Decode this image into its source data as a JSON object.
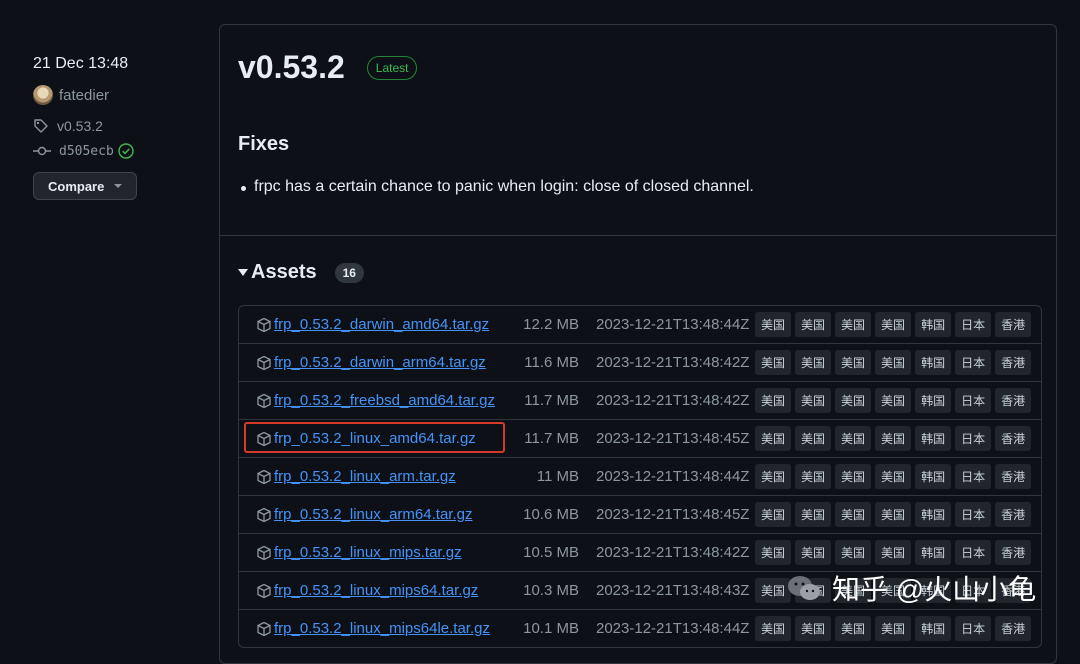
{
  "sidebar": {
    "date": "21 Dec 13:48",
    "author": "fatedier",
    "tag": "v0.53.2",
    "commit": "d505ecb",
    "compare_label": "Compare"
  },
  "release": {
    "version": "v0.53.2",
    "badge": "Latest",
    "fixes_heading": "Fixes",
    "fixes": [
      "frpc has a certain chance to panic when login: close of closed channel."
    ],
    "assets_heading": "Assets",
    "assets_count": "16",
    "mirror_labels": [
      "美国",
      "美国",
      "美国",
      "美国",
      "韩国",
      "日本",
      "香港"
    ],
    "assets": [
      {
        "name": "frp_0.53.2_darwin_amd64.tar.gz",
        "size": "12.2 MB",
        "time": "2023-12-21T13:48:44Z"
      },
      {
        "name": "frp_0.53.2_darwin_arm64.tar.gz",
        "size": "11.6 MB",
        "time": "2023-12-21T13:48:42Z"
      },
      {
        "name": "frp_0.53.2_freebsd_amd64.tar.gz",
        "size": "11.7 MB",
        "time": "2023-12-21T13:48:42Z"
      },
      {
        "name": "frp_0.53.2_linux_amd64.tar.gz",
        "size": "11.7 MB",
        "time": "2023-12-21T13:48:45Z",
        "highlighted": true
      },
      {
        "name": "frp_0.53.2_linux_arm.tar.gz",
        "size": "11 MB",
        "time": "2023-12-21T13:48:44Z"
      },
      {
        "name": "frp_0.53.2_linux_arm64.tar.gz",
        "size": "10.6 MB",
        "time": "2023-12-21T13:48:45Z"
      },
      {
        "name": "frp_0.53.2_linux_mips.tar.gz",
        "size": "10.5 MB",
        "time": "2023-12-21T13:48:42Z"
      },
      {
        "name": "frp_0.53.2_linux_mips64.tar.gz",
        "size": "10.3 MB",
        "time": "2023-12-21T13:48:43Z"
      },
      {
        "name": "frp_0.53.2_linux_mips64le.tar.gz",
        "size": "10.1 MB",
        "time": "2023-12-21T13:48:44Z"
      }
    ]
  },
  "watermark": "知乎 @火山小龟",
  "colors": {
    "link": "#4493f8",
    "latest_green": "#3fb950",
    "highlight_red": "#d73a2a"
  }
}
